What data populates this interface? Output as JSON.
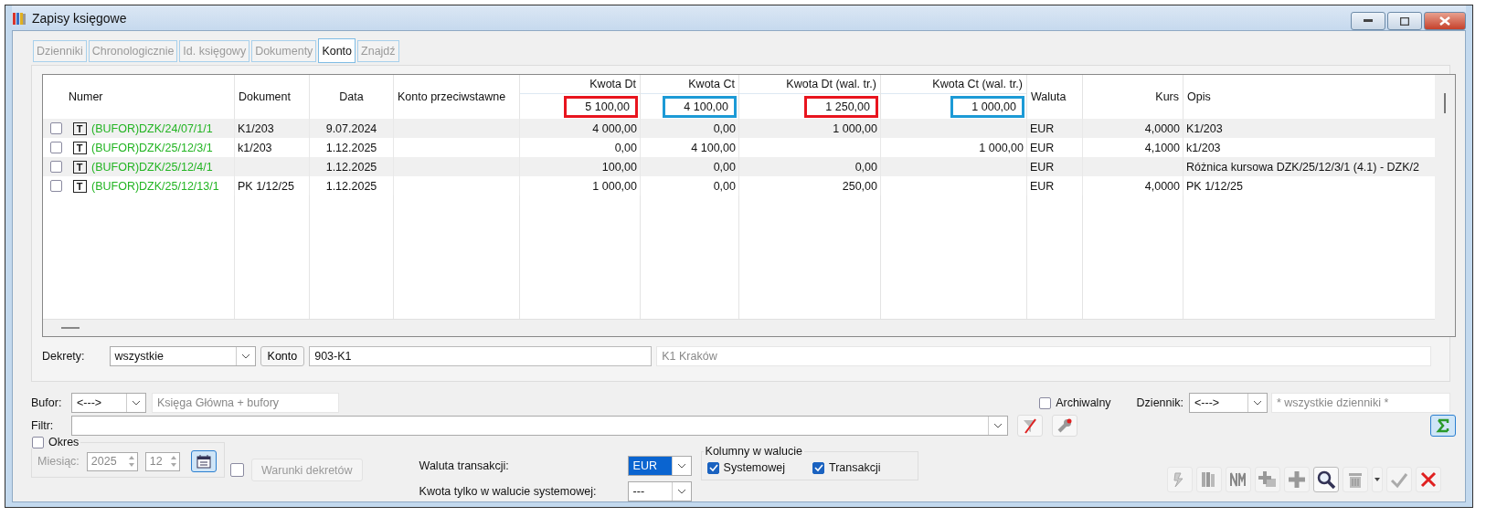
{
  "window": {
    "title": "Zapisy księgowe"
  },
  "tabs": [
    {
      "label": "Dzienniki",
      "selected": false
    },
    {
      "label": "Chronologicznie",
      "selected": false
    },
    {
      "label": "Id. księgowy",
      "selected": false
    },
    {
      "label": "Dokumenty",
      "selected": false
    },
    {
      "label": "Konto",
      "selected": true
    },
    {
      "label": "Znajdź",
      "selected": false
    }
  ],
  "table": {
    "columns": {
      "numer": "Numer",
      "dokument": "Dokument",
      "data": "Data",
      "konto": "Konto przeciwstawne",
      "kwota_dt": "Kwota Dt",
      "kwota_ct": "Kwota Ct",
      "kwota_dt_wal": "Kwota Dt (wal. tr.)",
      "kwota_ct_wal": "Kwota Ct (wal. tr.)",
      "waluta": "Waluta",
      "kurs": "Kurs",
      "opis": "Opis"
    },
    "totals": [
      {
        "value": "5 100,00",
        "color": "#e8141e"
      },
      {
        "value": "4 100,00",
        "color": "#1c9ad6"
      },
      {
        "value": "1 250,00",
        "color": "#e8141e"
      },
      {
        "value": "1 000,00",
        "color": "#1c9ad6"
      }
    ],
    "rows": [
      {
        "checked": false,
        "mark": "T",
        "numer": "(BUFOR)DZK/24/07/1/1",
        "dokument": "K1/203",
        "data": "9.07.2024",
        "kwota_dt": "4 000,00",
        "kwota_ct": "0,00",
        "kwota_dt_wal": "1 000,00",
        "kwota_ct_wal": "",
        "waluta": "EUR",
        "kurs": "4,0000",
        "opis": "K1/203"
      },
      {
        "checked": false,
        "mark": "T",
        "numer": "(BUFOR)DZK/25/12/3/1",
        "dokument": "k1/203",
        "data": "1.12.2025",
        "kwota_dt": "0,00",
        "kwota_ct": "4 100,00",
        "kwota_dt_wal": "",
        "kwota_ct_wal": "1 000,00",
        "waluta": "EUR",
        "kurs": "4,1000",
        "opis": "k1/203"
      },
      {
        "checked": false,
        "mark": "T",
        "numer": "(BUFOR)DZK/25/12/4/1",
        "dokument": "",
        "data": "1.12.2025",
        "kwota_dt": "100,00",
        "kwota_ct": "0,00",
        "kwota_dt_wal": "0,00",
        "kwota_ct_wal": "",
        "waluta": "EUR",
        "kurs": "",
        "opis": "Różnica kursowa DZK/25/12/3/1 (4.1) - DZK/2"
      },
      {
        "checked": false,
        "mark": "T",
        "numer": "(BUFOR)DZK/25/12/13/1",
        "dokument": "PK 1/12/25",
        "data": "1.12.2025",
        "kwota_dt": "1 000,00",
        "kwota_ct": "0,00",
        "kwota_dt_wal": "250,00",
        "kwota_ct_wal": "",
        "waluta": "EUR",
        "kurs": "4,0000",
        "opis": "PK 1/12/25"
      }
    ]
  },
  "dekrety": {
    "label": "Dekrety:",
    "value": "wszystkie",
    "button": "Konto",
    "account": "903-K1",
    "account_name": "K1 Kraków"
  },
  "bufor": {
    "label": "Bufor:",
    "value": "<--->",
    "description": "Księga Główna + bufory"
  },
  "archiwalny": {
    "label": "Archiwalny",
    "checked": false
  },
  "dziennik": {
    "label": "Dziennik:",
    "value": "<--->",
    "description": "* wszystkie dzienniki *"
  },
  "filtr": {
    "label": "Filtr:"
  },
  "okres": {
    "label": "Okres",
    "checked": false
  },
  "miesiac": {
    "label": "Miesiąc:",
    "year": "2025",
    "month": "12"
  },
  "warunki": {
    "label": "Warunki dekretów",
    "checked": false
  },
  "waluta_transakcji": {
    "label": "Waluta transakcji:",
    "value": "EUR"
  },
  "kwota_systemowa": {
    "label": "Kwota tylko w walucie systemowej:",
    "value": "---"
  },
  "kolumny": {
    "title": "Kolumny w walucie",
    "options": [
      {
        "label": "Systemowej",
        "checked": true
      },
      {
        "label": "Transakcji",
        "checked": true
      }
    ]
  }
}
